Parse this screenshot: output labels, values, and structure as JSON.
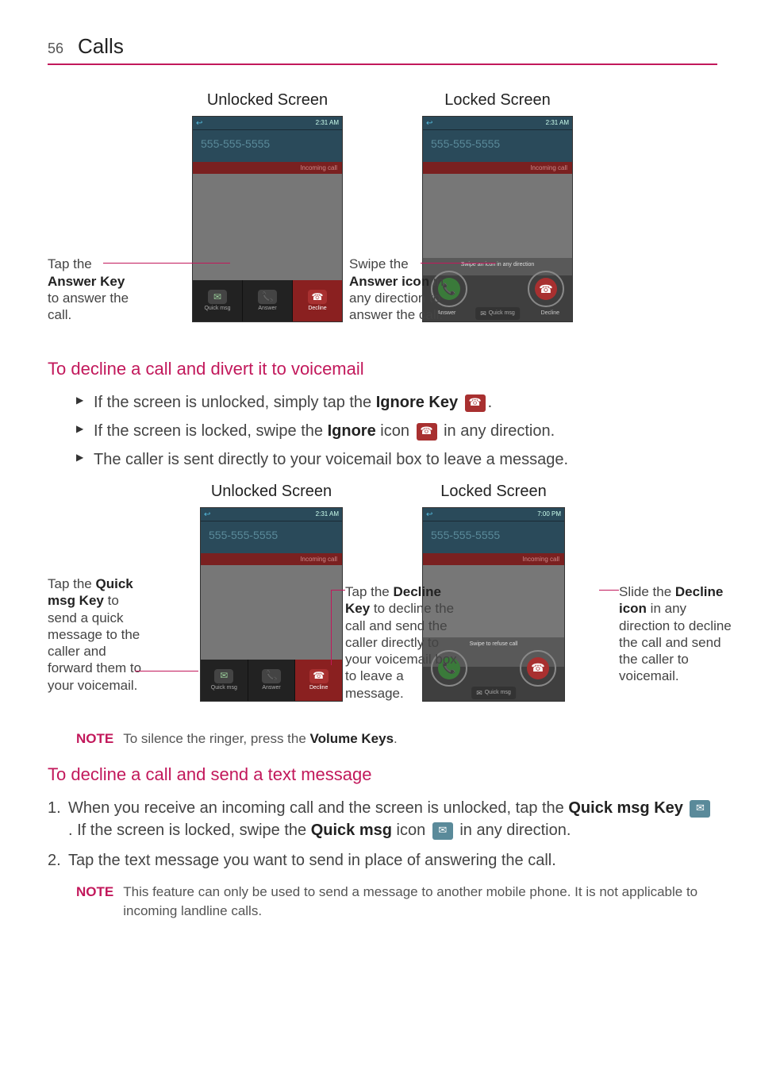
{
  "page_number": "56",
  "page_title": "Calls",
  "fig1": {
    "left_title": "Unlocked Screen",
    "right_title": "Locked Screen",
    "phone_number": "555-555-5555",
    "status_time": "2:31 AM",
    "incoming_label": "Incoming call",
    "btn_quick": "Quick msg",
    "btn_answer": "Answer",
    "btn_decline": "Decline",
    "swipe_hint": "Swipe an icon in any direction",
    "ring_answer": "Answer",
    "ring_decline": "Decline",
    "qmsg_label": "Quick msg",
    "callout_left_1": "Tap the",
    "callout_left_2": "Answer Key",
    "callout_left_3": "to answer the call.",
    "callout_right_1": "Swipe the",
    "callout_right_2": "Answer icon",
    "callout_right_3": " in any direction to answer the call."
  },
  "heading_decline": "To decline a call and divert it to voicemail",
  "bullets_decline": {
    "b1a": "If the screen is unlocked, simply tap the ",
    "b1b": "Ignore Key",
    "b1c": ".",
    "b2a": "If the screen is locked, swipe the ",
    "b2b": "Ignore",
    "b2c": " icon ",
    "b2d": " in any direction.",
    "b3": "The caller is sent directly to your voicemail box to leave a message."
  },
  "fig2": {
    "left_title": "Unlocked Screen",
    "right_title": "Locked Screen",
    "callout_quick_1": "Tap the ",
    "callout_quick_2": "Quick msg Key",
    "callout_quick_3": " to send a quick message to the caller and forward them to your voicemail.",
    "callout_decl_1": "Tap the ",
    "callout_decl_2": "Decline Key",
    "callout_decl_3": " to decline the call and send the caller directly to your voicemail box to leave a message.",
    "callout_slide_1": "Slide the ",
    "callout_slide_2": "Decline icon",
    "callout_slide_3": " in any direction to decline the call and send the caller to voicemail."
  },
  "note1_label": "NOTE",
  "note1_text_a": "To silence the ringer, press the ",
  "note1_text_b": "Volume Keys",
  "note1_text_c": ".",
  "heading_text": "To decline a call and send a text message",
  "steps": {
    "s1a": "When you receive an incoming call and the screen is unlocked, tap the ",
    "s1b": "Quick msg Key",
    "s1c": " . If the screen is locked, swipe the ",
    "s1d": "Quick msg",
    "s1e": " icon ",
    "s1f": " in any direction.",
    "s2": "Tap the text message you want to send in place of answering the call."
  },
  "note2_label": "NOTE",
  "note2_text": "This feature can only be used to send a message to another mobile phone. It is not applicable to incoming landline calls."
}
